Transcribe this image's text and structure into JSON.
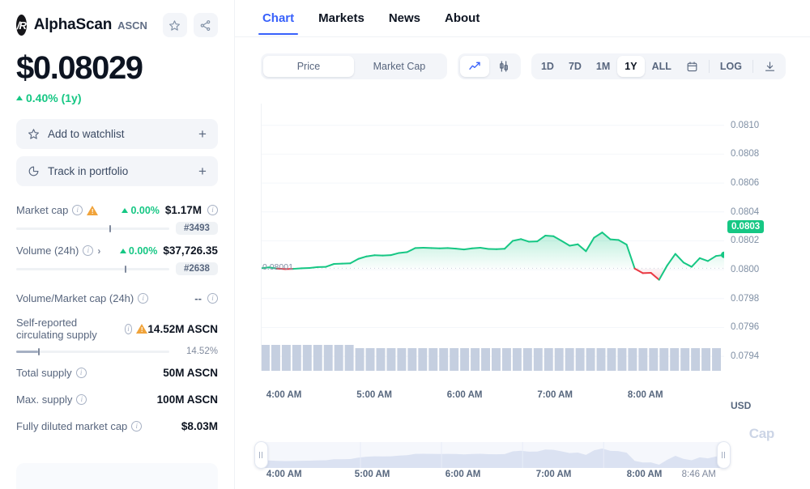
{
  "coin": {
    "name": "AlphaScan",
    "ticker": "ASCN",
    "logo_icon": "alphascan-logo-icon",
    "price": "$0.08029",
    "change": "0.40% (1y)",
    "change_direction": "up",
    "change_color": "#16c784",
    "watchlist_label": "Add to watchlist",
    "watchlist_plus": "+",
    "portfolio_label": "Track in portfolio",
    "portfolio_plus": "+"
  },
  "stats": {
    "market_cap": {
      "label": "Market cap",
      "pct": "0.00%",
      "value": "$1.17M",
      "rank": "#3493",
      "bar_pct": 61
    },
    "volume_24h": {
      "label": "Volume (24h)",
      "pct": "0.00%",
      "value": "$37,726.35",
      "rank": "#2638",
      "bar_pct": 71
    },
    "vol_mcap": {
      "label": "Volume/Market cap (24h)",
      "value": "--"
    },
    "circulating": {
      "label": "Self-reported circulating supply",
      "value": "14.52M ASCN",
      "pct_text": "14.52%",
      "bar_pct": 14.52
    },
    "total_supply": {
      "label": "Total supply",
      "value": "50M ASCN"
    },
    "max_supply": {
      "label": "Max. supply",
      "value": "100M ASCN"
    },
    "fdv": {
      "label": "Fully diluted market cap",
      "value": "$8.03M"
    }
  },
  "nav": {
    "tabs": [
      {
        "label": "Chart",
        "active": true
      },
      {
        "label": "Markets",
        "active": false
      },
      {
        "label": "News",
        "active": false
      },
      {
        "label": "About",
        "active": false
      }
    ]
  },
  "toolbar": {
    "metric": {
      "options": [
        "Price",
        "Market Cap"
      ],
      "selected": "Price"
    },
    "chart_type": {
      "options": [
        "line-chart-icon",
        "candlestick-icon"
      ],
      "selected": "line-chart-icon"
    },
    "ranges": {
      "options": [
        "1D",
        "7D",
        "1M",
        "1Y",
        "ALL"
      ],
      "selected": "1Y"
    },
    "calendar_icon": "calendar-icon",
    "log_label": "LOG",
    "download_icon": "download-icon"
  },
  "chart_data": {
    "type": "area",
    "title": "",
    "xlabel": "",
    "ylabel": "USD",
    "currency_label": "USD",
    "watermark": "Cap",
    "baseline_label": "0.08001",
    "baseline_value": 0.08001,
    "current_value": "0.0803",
    "current_badge_color": "#16c784",
    "up_color": "#16c784",
    "down_color": "#ea3943",
    "ylim": [
      0.0793,
      0.08115
    ],
    "yticks": [
      0.081,
      0.0808,
      0.0806,
      0.0804,
      0.0802,
      0.08,
      0.0798,
      0.0796,
      0.0794
    ],
    "ytick_labels": [
      "0.0810",
      "0.0808",
      "0.0806",
      "0.0804",
      "0.0802",
      "0.0800",
      "0.0798",
      "0.0796",
      "0.0794"
    ],
    "xticks": [
      "4:00 AM",
      "5:00 AM",
      "6:00 AM",
      "7:00 AM",
      "8:00 AM"
    ],
    "xtick_positions": [
      0.05,
      0.245,
      0.44,
      0.635,
      0.83
    ],
    "grid": true,
    "values": [
      0.08001,
      0.080016,
      0.080008,
      0.080004,
      0.080006,
      0.08001,
      0.080012,
      0.080018,
      0.08002,
      0.08004,
      0.080042,
      0.080044,
      0.080075,
      0.080092,
      0.0801,
      0.080098,
      0.080101,
      0.080116,
      0.080122,
      0.08015,
      0.080152,
      0.08015,
      0.080148,
      0.08015,
      0.080146,
      0.08014,
      0.080148,
      0.080152,
      0.080144,
      0.080142,
      0.080145,
      0.0802,
      0.080212,
      0.080194,
      0.080196,
      0.080236,
      0.080232,
      0.0802,
      0.080166,
      0.080176,
      0.080128,
      0.080222,
      0.080258,
      0.08021,
      0.080206,
      0.080174,
      0.080008,
      0.079976,
      0.079978,
      0.07993,
      0.08003,
      0.08011,
      0.08005,
      0.08002,
      0.08008,
      0.08006,
      0.080095,
      0.080103
    ],
    "volume_bars_count": 44,
    "navigator": {
      "left_handle": "range-handle-left",
      "right_handle": "range-handle-right",
      "xticks": [
        "4:00 AM",
        "5:00 AM",
        "6:00 AM",
        "7:00 AM",
        "8:00 AM",
        "8:46 AM"
      ],
      "xtick_positions": [
        0.045,
        0.215,
        0.39,
        0.565,
        0.74,
        0.845
      ]
    }
  }
}
